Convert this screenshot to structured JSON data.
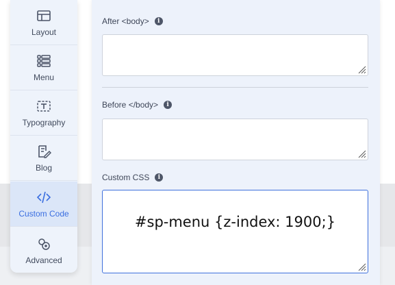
{
  "sidebar": {
    "items": [
      {
        "label": "Layout",
        "icon": "layout-icon"
      },
      {
        "label": "Menu",
        "icon": "menu-icon"
      },
      {
        "label": "Typography",
        "icon": "typography-icon"
      },
      {
        "label": "Blog",
        "icon": "blog-icon"
      },
      {
        "label": "Custom Code",
        "icon": "code-icon",
        "active": true
      },
      {
        "label": "Advanced",
        "icon": "advanced-icon"
      }
    ]
  },
  "fields": {
    "after_body": {
      "label": "After <body>",
      "value": ""
    },
    "before_body": {
      "label": "Before </body>",
      "value": ""
    },
    "custom_css": {
      "label": "Custom CSS",
      "value": "#sp-menu {z-index: 1900;}"
    }
  },
  "colors": {
    "accent": "#3a6ee0",
    "panel_bg": "#edf2fb",
    "sidebar_bg": "#eef3fb",
    "active_bg": "#dbe6f8"
  }
}
